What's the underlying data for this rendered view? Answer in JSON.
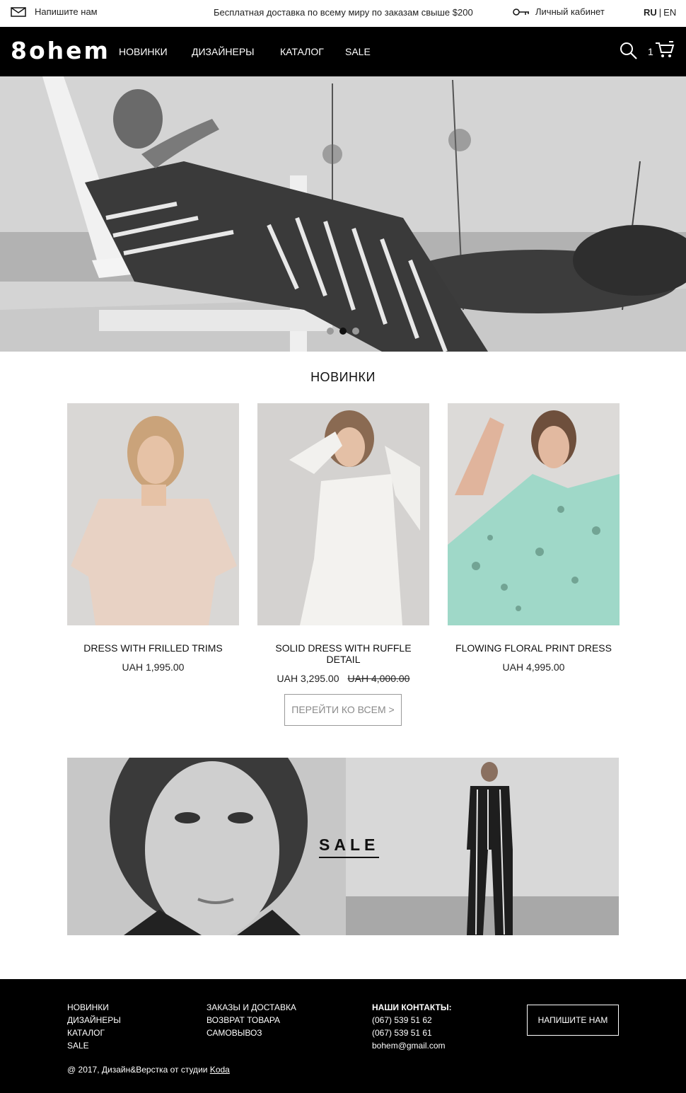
{
  "topbar": {
    "write_us": "Напишите нам",
    "promo": "Бесплатная доставка по всему миру по заказам свыше $200",
    "account": "Личный кабинет",
    "lang_ru": "RU",
    "lang_sep": "|",
    "lang_en": "EN"
  },
  "nav": {
    "logo": "8ohem",
    "items": [
      "НОВИНКИ",
      "ДИЗАЙНЕРЫ",
      "КАТАЛОГ",
      "SALE"
    ],
    "cart_count": "1",
    "search_icon": "search-icon",
    "cart_icon": "cart-icon"
  },
  "hero": {
    "slides_total": 3,
    "active_slide": 2
  },
  "new_arrivals": {
    "title": "НОВИНКИ",
    "products": [
      {
        "name": "DRESS WITH FRILLED TRIMS",
        "price": "UAH 1,995.00",
        "old_price": ""
      },
      {
        "name": "SOLID DRESS WITH RUFFLE DETAIL",
        "price": "UAH 3,295.00",
        "old_price": "UAH 4,000.00"
      },
      {
        "name": "FLOWING FLORAL PRINT DRESS",
        "price": "UAH 4,995.00",
        "old_price": ""
      }
    ],
    "view_all": "ПЕРЕЙТИ КО ВСЕМ >"
  },
  "sale_banner": {
    "label": "SALE"
  },
  "footer": {
    "col1": [
      "НОВИНКИ",
      "ДИЗАЙНЕРЫ",
      "КАТАЛОГ",
      "SALE"
    ],
    "col2": [
      "ЗАКАЗЫ И ДОСТАВКА",
      "ВОЗВРАТ ТОВАРА",
      "САМОВЫВОЗ"
    ],
    "contacts_title": "НАШИ КОНТАКТЫ:",
    "phones": [
      "(067) 539 51 62",
      "(067) 539 51 61"
    ],
    "email": "bohem@gmail.com",
    "button": "НАПИШИТЕ НАМ",
    "copyright_prefix": "@ 2017,  Дизайн&Верстка от студии",
    "studio": "Koda"
  }
}
